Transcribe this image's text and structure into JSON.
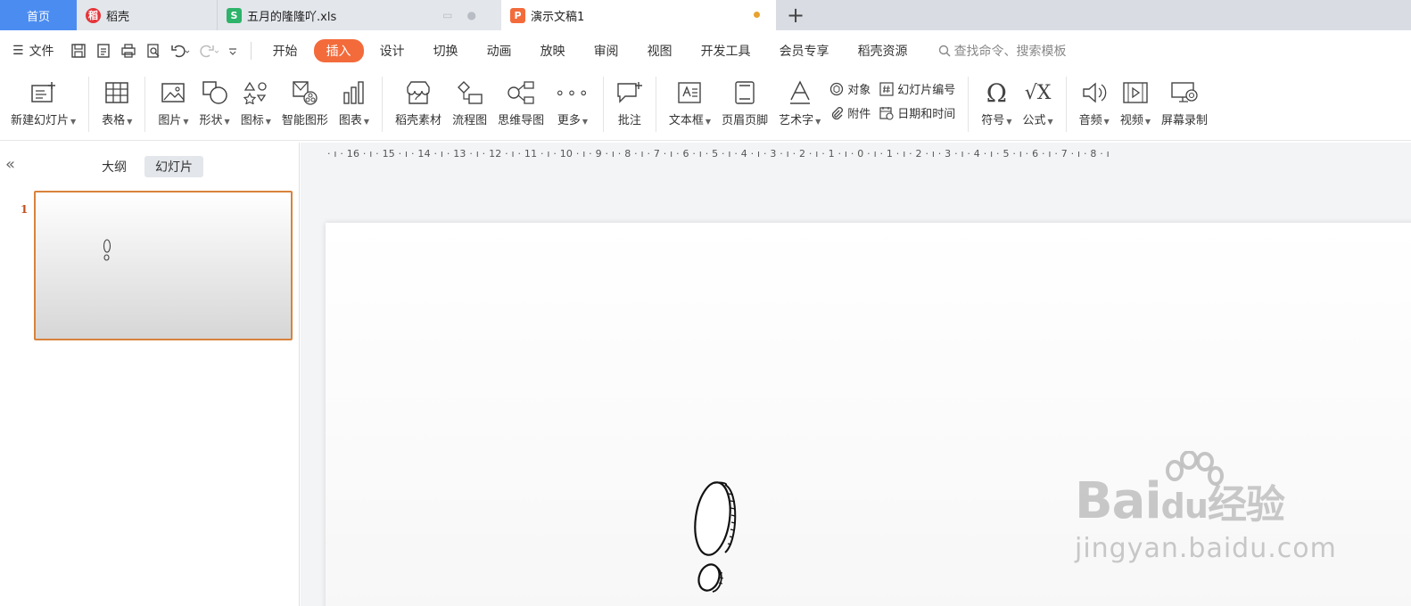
{
  "tabs": [
    {
      "label": "首页"
    },
    {
      "label": "稻壳",
      "logo": "稻"
    },
    {
      "label": "五月的隆隆吖.xls",
      "logo": "S"
    },
    {
      "label": "演示文稿1",
      "logo": "P"
    }
  ],
  "tab_add": "+",
  "menubar": {
    "file_label": "文件",
    "tabs": [
      "开始",
      "插入",
      "设计",
      "切换",
      "动画",
      "放映",
      "审阅",
      "视图",
      "开发工具",
      "会员专享",
      "稻壳资源"
    ],
    "active_tab": "插入",
    "search_placeholder": "查找命令、搜索模板"
  },
  "ribbon": {
    "new_slide": "新建幻灯片",
    "table": "表格",
    "picture": "图片",
    "shape": "形状",
    "icon": "图标",
    "smartart": "智能图形",
    "chart": "图表",
    "docer_material": "稻壳素材",
    "flowchart": "流程图",
    "mindmap": "思维导图",
    "more": "更多",
    "comment": "批注",
    "textbox": "文本框",
    "header_footer": "页眉页脚",
    "wordart": "艺术字",
    "object": "对象",
    "attachment": "附件",
    "slide_number": "幻灯片编号",
    "datetime": "日期和时间",
    "symbol": "符号",
    "formula": "公式",
    "audio": "音频",
    "video": "视频",
    "screen_record": "屏幕录制"
  },
  "left_panel": {
    "views": [
      "大纲",
      "幻灯片"
    ],
    "active_view": "幻灯片",
    "slide_number": "1"
  },
  "ruler": "· ı · 16 · ı · 15 · ı · 14 · ı · 13 · ı · 12 · ı · 11 · ı · 10 · ı · 9 · ı · 8 · ı · 7 · ı · 6 · ı · 5 · ı · 4 · ı · 3 · ı · 2 · ı · 1 · ı · 0 · ı · 1 · ı · 2 · ı · 3 · ı · 4 · ı · 5 · ı · 6 · ı · 7 · ı · 8 · ı",
  "watermark": {
    "brand_a": "Bai",
    "brand_b": "du",
    "brand_c": "经验",
    "site": "jingyan.baidu.com"
  },
  "colors": {
    "home_tab": "#4b8cf0",
    "active_menu": "#f36b3b",
    "thumb_border": "#d9823b",
    "wps_red": "#e5353a",
    "sheet_green": "#2db36a"
  }
}
